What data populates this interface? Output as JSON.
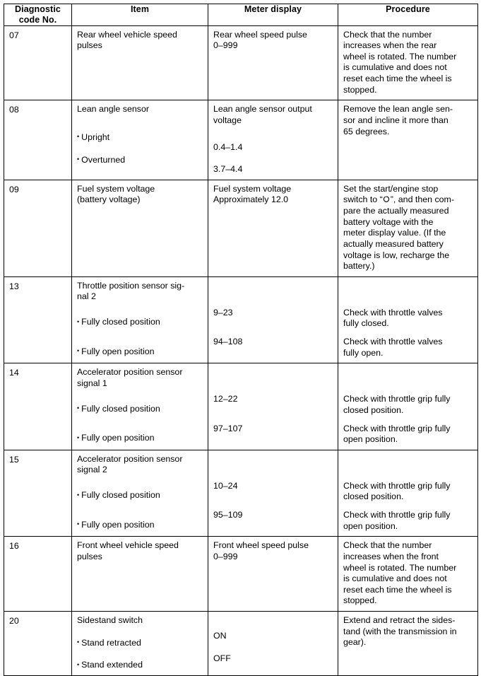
{
  "table": {
    "headers": {
      "code": "Diagnostic\ncode No.",
      "code_line1": "Diagnostic",
      "code_line2": "code No.",
      "item": "Item",
      "meter": "Meter display",
      "procedure": "Procedure"
    },
    "rows": [
      {
        "code": "07",
        "item_lines": [
          "Rear wheel vehicle speed",
          "pulses"
        ],
        "meter_lines": [
          "Rear wheel speed pulse",
          "0–999"
        ],
        "procedure_lines": [
          "Check that the number",
          "increases when the rear",
          "wheel is rotated. The number",
          "is cumulative and does not",
          "reset each time the wheel is",
          "stopped."
        ]
      },
      {
        "code": "08",
        "item_lines": [
          "Lean angle sensor"
        ],
        "item_bullets": [
          "Upright",
          "Overturned"
        ],
        "meter_lines": [
          "Lean angle sensor output",
          "voltage"
        ],
        "meter_bullet_values": [
          "0.4–1.4",
          "3.7–4.4"
        ],
        "procedure_lines": [
          "Remove the lean angle sen-",
          "sor and incline it more than",
          "65 degrees."
        ]
      },
      {
        "code": "09",
        "item_lines": [
          "Fuel system voltage",
          "(battery voltage)"
        ],
        "meter_lines": [
          "Fuel system voltage",
          "Approximately 12.0"
        ],
        "procedure_lines_a": [
          "Set the start/engine stop"
        ],
        "procedure_run_prefix": "switch to “",
        "procedure_run_suffix": "”, and then com-",
        "procedure_lines_b": [
          "pare the actually measured",
          "battery voltage with the",
          "meter display value. (If the",
          "actually measured battery",
          "voltage is low, recharge the",
          "battery.)"
        ],
        "run_symbol_name": "engine-run-symbol"
      },
      {
        "code": "13",
        "item_lines": [
          "Throttle position sensor sig-",
          "nal 2"
        ],
        "item_bullets": [
          "Fully closed position",
          "Fully open position"
        ],
        "meter_bullet_values": [
          "9–23",
          "94–108"
        ],
        "procedure_bullets": [
          [
            "Check with throttle valves",
            "fully closed."
          ],
          [
            "Check with throttle valves",
            "fully open."
          ]
        ]
      },
      {
        "code": "14",
        "item_lines": [
          "Accelerator position sensor",
          "signal 1"
        ],
        "item_bullets": [
          "Fully closed position",
          "Fully open position"
        ],
        "meter_bullet_values": [
          "12–22",
          "97–107"
        ],
        "procedure_bullets": [
          [
            "Check with throttle grip fully",
            "closed position."
          ],
          [
            "Check with throttle grip fully",
            "open position."
          ]
        ]
      },
      {
        "code": "15",
        "item_lines": [
          "Accelerator position sensor",
          "signal 2"
        ],
        "item_bullets": [
          "Fully closed position",
          "Fully open position"
        ],
        "meter_bullet_values": [
          "10–24",
          "95–109"
        ],
        "procedure_bullets": [
          [
            "Check with throttle grip fully",
            "closed position."
          ],
          [
            "Check with throttle grip fully",
            "open position."
          ]
        ]
      },
      {
        "code": "16",
        "item_lines": [
          "Front wheel vehicle speed",
          "pulses"
        ],
        "meter_lines": [
          "Front wheel speed pulse",
          "0–999"
        ],
        "procedure_lines": [
          "Check that the number",
          "increases when the front",
          "wheel is rotated. The number",
          "is cumulative and does not",
          "reset each time the wheel is",
          "stopped."
        ]
      },
      {
        "code": "20",
        "item_lines": [
          "Sidestand switch"
        ],
        "item_bullets": [
          "Stand retracted",
          "Stand extended"
        ],
        "meter_bullet_values": [
          "ON",
          "OFF"
        ],
        "procedure_lines": [
          "Extend and retract the sides-",
          "tand (with the transmission in",
          "gear)."
        ]
      }
    ],
    "bullet_glyph": "•"
  }
}
